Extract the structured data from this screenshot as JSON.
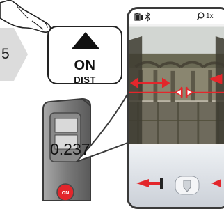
{
  "step": {
    "number": "5"
  },
  "button": {
    "top_label": "ON",
    "bottom_label": "DIST"
  },
  "device_keys": {
    "on_key_label": "ON"
  },
  "screen": {
    "zoom_label": "1x",
    "distance_value": "0.237"
  },
  "colors": {
    "accent_red": "#e3262b",
    "tab_gray": "#dcdcdc",
    "device_body": "#8a8a8a"
  },
  "icons": [
    "pointing-hand-icon",
    "battery-icon",
    "bluetooth-icon",
    "zoom-icon",
    "target-marker-icon",
    "measure-start-icon"
  ]
}
